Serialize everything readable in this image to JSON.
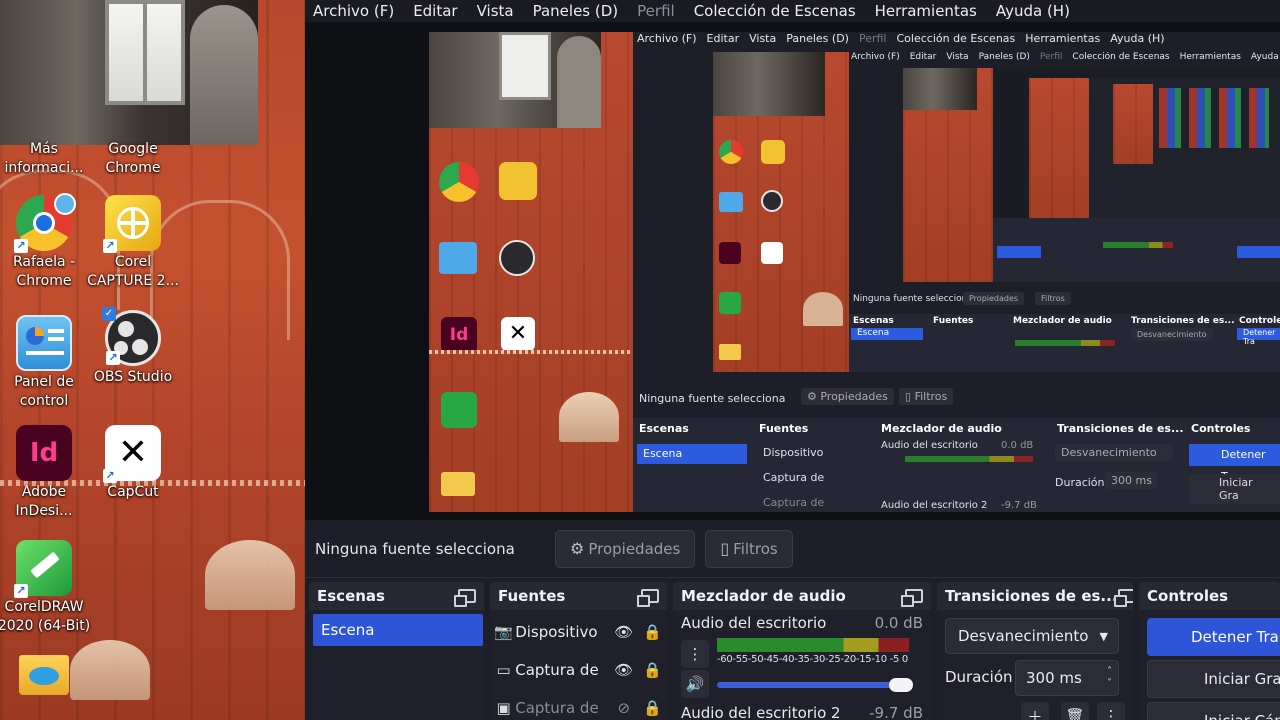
{
  "desktop": {
    "icons": [
      {
        "label": "Más\ninformaci...",
        "glyph": "info-icon"
      },
      {
        "label": "Google\nChrome",
        "glyph": "chrome-icon"
      },
      {
        "label": "Rafaela -\nChrome",
        "glyph": "chrome-profile-icon"
      },
      {
        "label": "Corel\nCAPTURE 2...",
        "glyph": "corel-capture-icon"
      },
      {
        "label": "Panel de\ncontrol",
        "glyph": "control-panel-icon"
      },
      {
        "label": "OBS Studio",
        "glyph": "obs-icon"
      },
      {
        "label": "Adobe\nInDesi...",
        "glyph": "indesign-icon",
        "glyph_text": "Id"
      },
      {
        "label": "CapCut",
        "glyph": "capcut-icon"
      },
      {
        "label": "CorelDRAW\n2020 (64-Bit)",
        "glyph": "coreldraw-icon"
      },
      {
        "label": "",
        "glyph": "folder-icon"
      }
    ]
  },
  "menu": {
    "items": [
      "Archivo (F)",
      "Editar",
      "Vista",
      "Paneles (D)",
      "Perfil",
      "Colección de Escenas",
      "Herramientas",
      "Ayuda (H)"
    ],
    "disabled_index": 4
  },
  "preview": {
    "l1": {
      "no_source": "Ninguna fuente selecciona",
      "props": "Propiedades",
      "filters": "Filtros",
      "docks": [
        "Escenas",
        "Fuentes",
        "Mezclador de audio",
        "Transiciones de es...",
        "Controles"
      ],
      "scene": "Escena",
      "sources": [
        "Dispositivo",
        "Captura de",
        "Captura de"
      ],
      "audio1": "Audio del escritorio",
      "audio1_db": "0.0 dB",
      "audio2": "Audio del escritorio 2",
      "audio2_db": "-9.7 dB",
      "transition": "Desvanecimiento",
      "duration_label": "Duración",
      "duration": "300 ms",
      "stop": "Detener Tra",
      "record": "Iniciar Gra"
    }
  },
  "sources_bar": {
    "no_source": "Ninguna fuente selecciona",
    "properties": "Propiedades",
    "filters": "Filtros"
  },
  "docks": {
    "scenes": {
      "title": "Escenas",
      "items": [
        "Escena"
      ]
    },
    "sources": {
      "title": "Fuentes",
      "items": [
        {
          "name": "Dispositivo",
          "icon": "camera-icon",
          "visible": true
        },
        {
          "name": "Captura de",
          "icon": "monitor-icon",
          "visible": true
        },
        {
          "name": "Captura de",
          "icon": "window-icon",
          "visible": false
        }
      ]
    },
    "mixer": {
      "title": "Mezclador de audio",
      "channels": [
        {
          "name": "Audio del escritorio",
          "db": "0.0 dB",
          "level_fraction": 1.0
        },
        {
          "name": "Audio del escritorio 2",
          "db": "-9.7 dB"
        }
      ],
      "scale": "-60-55-50-45-40-35-30-25-20-15-10 -5  0"
    },
    "transitions": {
      "title": "Transiciones de es...",
      "selected": "Desvanecimiento",
      "duration_label": "Duración",
      "duration": "300 ms"
    },
    "controls": {
      "title": "Controles",
      "stop_stream": "Detener Tra",
      "start_record": "Iniciar Gra",
      "third": "Iniciar Cám"
    }
  },
  "colors": {
    "accent": "#2e55d8",
    "panel": "#1d1e27",
    "dock_header": "#262834"
  }
}
